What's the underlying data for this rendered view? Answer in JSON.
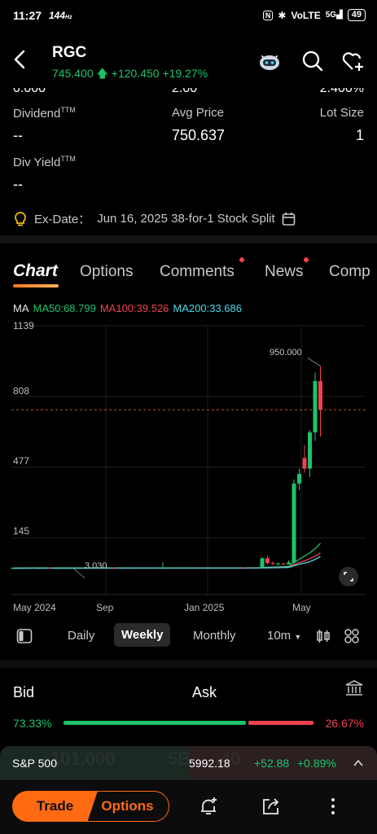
{
  "status": {
    "time": "11:27",
    "hz": "144",
    "hz_unit": "Hz",
    "network": "VoLTE",
    "signal": "5G",
    "battery": "49"
  },
  "header": {
    "ticker": "RGC",
    "price": "745.400",
    "change": "+120.450",
    "change_pct": "+19.27%"
  },
  "stats": {
    "partial_row": [
      "0.000",
      "2.00",
      "2.400%"
    ],
    "dividend_label": "Dividend",
    "dividend_sup": "TTM",
    "dividend_value": "--",
    "avg_price_label": "Avg Price",
    "avg_price_value": "750.637",
    "lot_size_label": "Lot Size",
    "lot_size_value": "1",
    "div_yield_label": "Div Yield",
    "div_yield_sup": "TTM",
    "div_yield_value": "--"
  },
  "exdate": {
    "label": "Ex-Date：",
    "text": "Jun 16, 2025 38-for-1 Stock Split"
  },
  "tabs": [
    "Chart",
    "Options",
    "Comments",
    "News",
    "Comp"
  ],
  "ma": {
    "label": "MA",
    "ma50": "MA50:68.799",
    "ma100": "MA100:39.526",
    "ma200": "MA200:33.686",
    "ma50_color": "#1fc26b",
    "ma100_color": "#f0414f",
    "ma200_color": "#4fd8e8"
  },
  "chart_data": {
    "type": "candlestick",
    "y_ticks": [
      "1139",
      "808",
      "477",
      "145"
    ],
    "ylim": [
      -120,
      1139
    ],
    "x_ticks": [
      "May 2024",
      "Sep",
      "Jan 2025",
      "May"
    ],
    "high_label": "950.000",
    "low_label": "3.030",
    "current_price_line": 745.4,
    "candles": [
      {
        "o": 3.5,
        "h": 4.6,
        "l": 3.03,
        "c": 4.0
      },
      {
        "o": 4.0,
        "h": 6.0,
        "l": 3.5,
        "c": 5.0
      },
      {
        "o": 5.0,
        "h": 5.5,
        "l": 3.8,
        "c": 4.2
      },
      {
        "o": 4.2,
        "h": 4.8,
        "l": 3.6,
        "c": 4.4
      },
      {
        "o": 4.4,
        "h": 4.9,
        "l": 3.9,
        "c": 4.1
      },
      {
        "o": 4.1,
        "h": 30.0,
        "l": 3.8,
        "c": 4.3
      },
      {
        "o": 4.3,
        "h": 4.7,
        "l": 3.9,
        "c": 4.0
      },
      {
        "o": 5.0,
        "h": 55.0,
        "l": 4.0,
        "c": 50.0
      },
      {
        "o": 50.0,
        "h": 62.0,
        "l": 20.0,
        "c": 28.0
      },
      {
        "o": 28.0,
        "h": 35.0,
        "l": 18.0,
        "c": 24.0
      },
      {
        "o": 24.0,
        "h": 30.0,
        "l": 18.0,
        "c": 25.0
      },
      {
        "o": 25.0,
        "h": 28.0,
        "l": 20.0,
        "c": 22.0
      },
      {
        "o": 22.0,
        "h": 40.0,
        "l": 20.0,
        "c": 30.0
      },
      {
        "o": 30.0,
        "h": 420.0,
        "l": 25.0,
        "c": 400.0
      },
      {
        "o": 400.0,
        "h": 470.0,
        "l": 370.0,
        "c": 445.0
      },
      {
        "o": 520.0,
        "h": 580.0,
        "l": 450.0,
        "c": 470.0
      },
      {
        "o": 470.0,
        "h": 650.0,
        "l": 430.0,
        "c": 640.0
      },
      {
        "o": 640.0,
        "h": 920.0,
        "l": 600.0,
        "c": 880.0
      },
      {
        "o": 880.0,
        "h": 950.0,
        "l": 620.0,
        "c": 745.4
      }
    ],
    "ma_lines": {
      "ma50": [
        4.0,
        4.2,
        4.3,
        4.3,
        4.3,
        4.4,
        4.5,
        6.0,
        8.0,
        9.0,
        10.0,
        11.0,
        12.0,
        30.0,
        45.0,
        60.0,
        75.0,
        95.0,
        120.0
      ],
      "ma100": [
        3.8,
        3.9,
        4.0,
        4.0,
        4.1,
        4.1,
        4.2,
        5.0,
        6.0,
        6.5,
        7.0,
        7.5,
        8.0,
        20.0,
        30.0,
        38.0,
        48.0,
        60.0,
        75.0
      ],
      "ma200": [
        3.6,
        3.7,
        3.8,
        3.8,
        3.9,
        3.9,
        4.0,
        4.5,
        5.0,
        5.5,
        6.0,
        6.5,
        7.0,
        15.0,
        22.0,
        28.0,
        34.0,
        45.0,
        58.0
      ]
    }
  },
  "period": {
    "daily": "Daily",
    "weekly": "Weekly",
    "monthly": "Monthly",
    "minutes": "10m"
  },
  "bidask": {
    "bid": "Bid",
    "ask": "Ask",
    "bid_pct": "73.33%",
    "ask_pct": "26.67%"
  },
  "index": {
    "name": "S&P 500",
    "value": "5992.18",
    "change": "+52.88",
    "change_pct": "+0.89%",
    "ghost_left": "101.000",
    "ghost_right": "5B  ...  .40"
  },
  "bottom": {
    "trade": "Trade",
    "options": "Options"
  }
}
